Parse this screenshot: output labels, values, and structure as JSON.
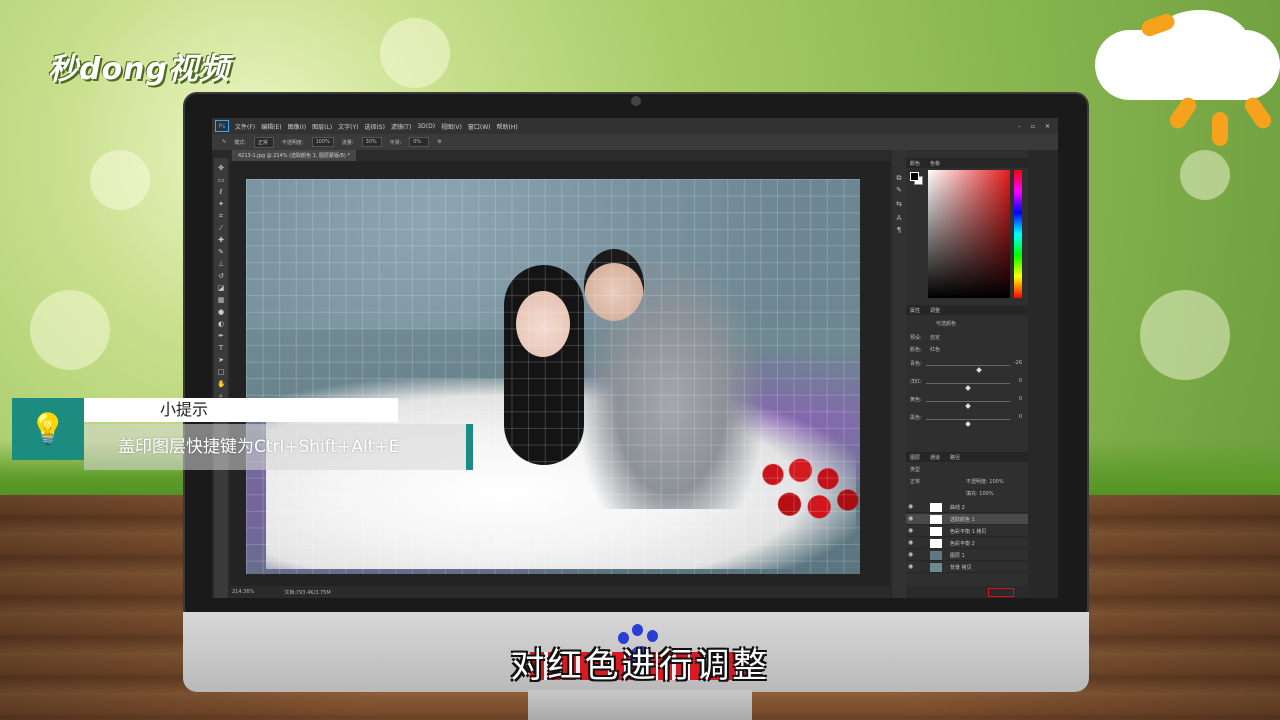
{
  "branding": {
    "logo_text": "秒dong视频"
  },
  "photoshop": {
    "menu": [
      "文件(F)",
      "编辑(E)",
      "图像(I)",
      "图层(L)",
      "文字(Y)",
      "选择(S)",
      "滤镜(T)",
      "3D(D)",
      "视图(V)",
      "窗口(W)",
      "帮助(H)"
    ],
    "ps_logo": "Ps",
    "options": {
      "mode_label": "模式:",
      "mode_value": "正常",
      "opacity_label": "不透明度:",
      "opacity_value": "100%",
      "flow_label": "流量:",
      "flow_value": "30%",
      "smooth_label": "平滑:",
      "smooth_value": "0%"
    },
    "document_tab": "4213-1.jpg @ 214% (选取颜色 1, 图层蒙版/8) *",
    "status": {
      "zoom": "214.36%",
      "doc": "文档:793.4K/3.75M"
    },
    "color_panel_tabs": [
      "颜色",
      "色板"
    ],
    "properties_tabs": [
      "属性",
      "调整"
    ],
    "properties": {
      "title": "可选颜色",
      "preset_label": "预设:",
      "preset_value": "自定",
      "colors_label": "颜色:",
      "colors_value": "红色",
      "rows": [
        {
          "label": "青色:",
          "value": "-26",
          "pos": 0.63
        },
        {
          "label": "洋红:",
          "value": "0",
          "pos": 0.5
        },
        {
          "label": "黄色:",
          "value": "0",
          "pos": 0.5
        },
        {
          "label": "黑色:",
          "value": "0",
          "pos": 0.5
        }
      ]
    },
    "layers_tabs": [
      "图层",
      "通道",
      "路径"
    ],
    "layers_kind": "类型",
    "layers_blend": "正常",
    "layers_opacity": "不透明度: 100%",
    "layers_fill": "填充: 100%",
    "layers": [
      {
        "name": "曲线 2",
        "active": false
      },
      {
        "name": "选取颜色 1",
        "active": true
      },
      {
        "name": "色彩平衡 1 拷贝",
        "active": false
      },
      {
        "name": "色彩平衡 2",
        "active": false
      },
      {
        "name": "图层 1",
        "active": false
      },
      {
        "name": "背景 拷贝",
        "active": false
      }
    ]
  },
  "tip": {
    "title": "小提示",
    "body": "盖印图层快捷键为Ctrl+Shift+Alt+E"
  },
  "subtitle": "对红色进行调整",
  "colors": {
    "accent_teal": "#1c8c80",
    "highlight_red": "#e01010"
  }
}
